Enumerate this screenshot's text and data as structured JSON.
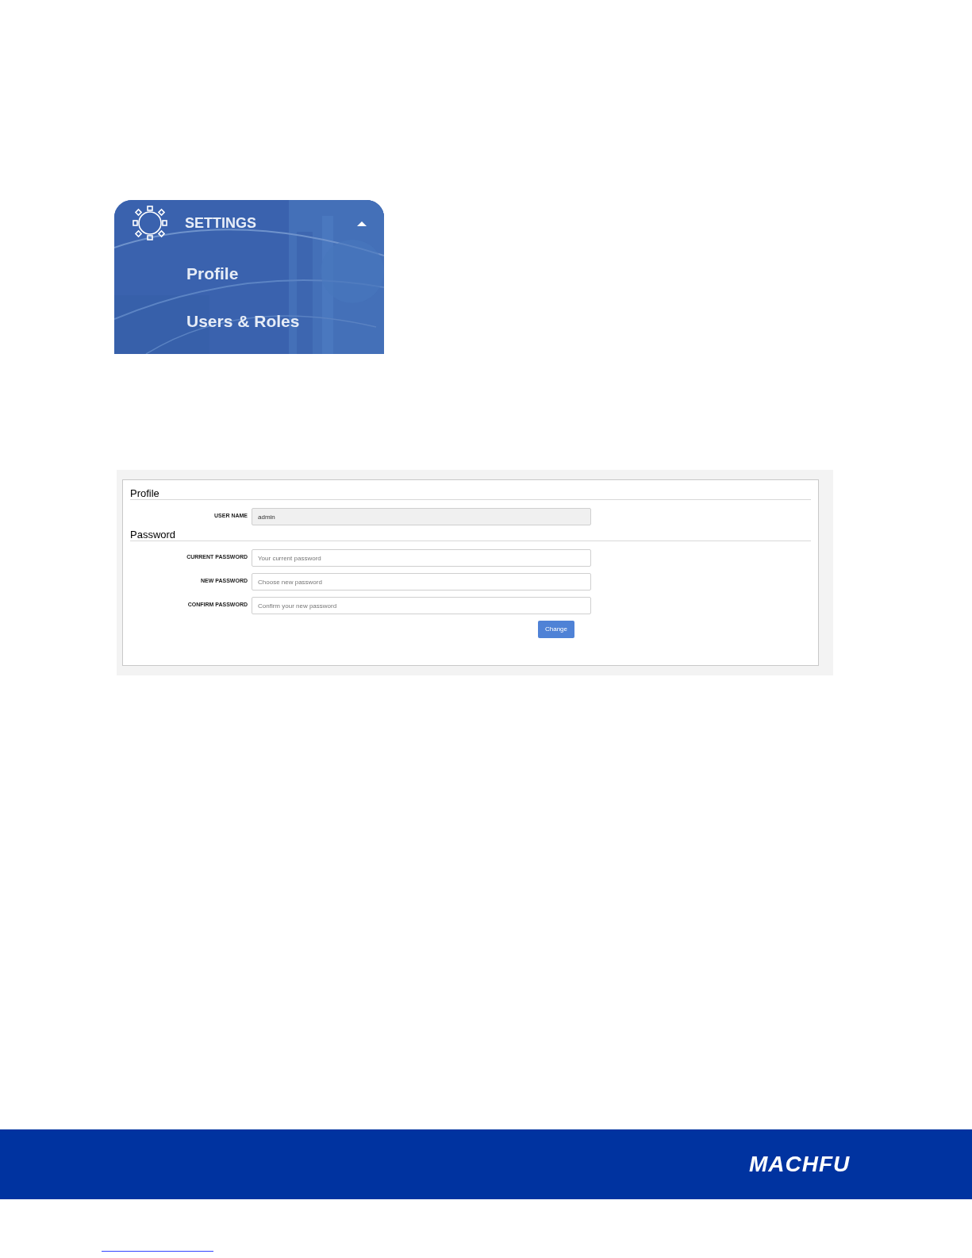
{
  "settings_menu": {
    "title": "SETTINGS",
    "expanded": true,
    "items": [
      {
        "label": "Profile"
      },
      {
        "label": "Users & Roles"
      }
    ]
  },
  "profile_form": {
    "sections": [
      {
        "title": "Profile",
        "fields": [
          {
            "label": "USER NAME",
            "value": "admin",
            "disabled": true
          }
        ]
      },
      {
        "title": "Password",
        "fields": [
          {
            "label": "CURRENT PASSWORD",
            "placeholder": "Your current password",
            "disabled": false
          },
          {
            "label": "NEW PASSWORD",
            "placeholder": "Choose new password",
            "disabled": false
          },
          {
            "label": "CONFIRM PASSWORD",
            "placeholder": "Confirm your new password",
            "disabled": false
          }
        ]
      }
    ],
    "button": "Change"
  },
  "footer": {
    "logo": "MACHFU"
  }
}
